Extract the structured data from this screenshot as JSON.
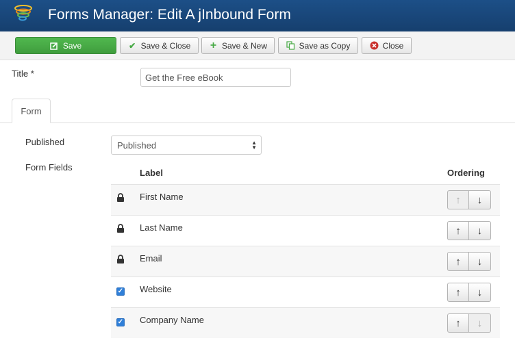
{
  "header": {
    "title": "Forms Manager: Edit A jInbound Form"
  },
  "toolbar": {
    "save": "Save",
    "save_close": "Save & Close",
    "save_new": "Save & New",
    "save_copy": "Save as Copy",
    "close": "Close"
  },
  "title_field": {
    "label": "Title *",
    "value": "Get the Free eBook"
  },
  "tabs": [
    {
      "label": "Form",
      "active": true
    }
  ],
  "published": {
    "label": "Published",
    "selected": "Published"
  },
  "form_fields": {
    "label": "Form Fields",
    "columns": {
      "label": "Label",
      "ordering": "Ordering"
    },
    "rows": [
      {
        "label": "First Name",
        "icon": "lock-icon",
        "up_disabled": true,
        "down_disabled": false
      },
      {
        "label": "Last Name",
        "icon": "lock-icon",
        "up_disabled": false,
        "down_disabled": false
      },
      {
        "label": "Email",
        "icon": "lock-icon",
        "up_disabled": false,
        "down_disabled": false
      },
      {
        "label": "Website",
        "icon": "checkbox-checked",
        "up_disabled": false,
        "down_disabled": false
      },
      {
        "label": "Company Name",
        "icon": "checkbox-checked",
        "up_disabled": false,
        "down_disabled": true
      }
    ]
  },
  "colors": {
    "header": "#1c4f87",
    "save_button": "#46a944",
    "checkbox": "#2f7fd8"
  }
}
